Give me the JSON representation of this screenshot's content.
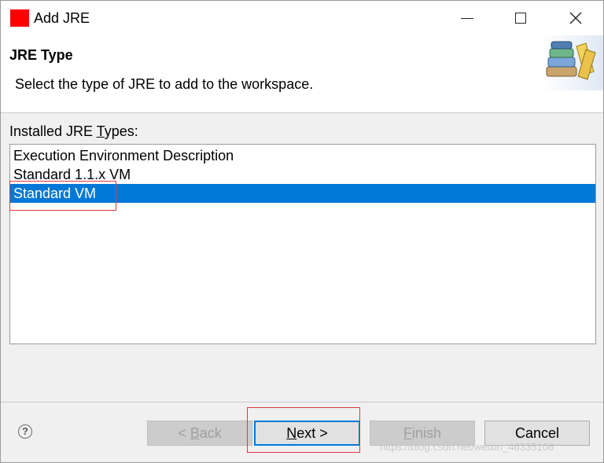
{
  "window": {
    "title": "Add JRE",
    "minimize_icon": "minimize-icon",
    "maximize_icon": "maximize-icon",
    "close_icon": "close-icon"
  },
  "banner": {
    "title": "JRE Type",
    "description": "Select the type of JRE to add to the workspace.",
    "icon": "books-icon"
  },
  "list": {
    "label_prefix": "Installed JRE ",
    "label_mnemonic": "T",
    "label_suffix": "ypes:",
    "items": [
      "Execution Environment Description",
      "Standard 1.1.x VM",
      "Standard VM"
    ],
    "selected_index": 2
  },
  "buttons": {
    "back_prefix": "< ",
    "back_mnemonic": "B",
    "back_suffix": "ack",
    "next_mnemonic": "N",
    "next_suffix": "ext >",
    "finish_mnemonic": "F",
    "finish_suffix": "inish",
    "cancel": "Cancel",
    "help_icon": "help-icon",
    "help_glyph": "?"
  },
  "watermark": "https://blog.csdn.net/weixin_46335106",
  "colors": {
    "app_icon": "#ff0000",
    "selection": "#0078d7",
    "highlight_box": "#e0383f"
  }
}
